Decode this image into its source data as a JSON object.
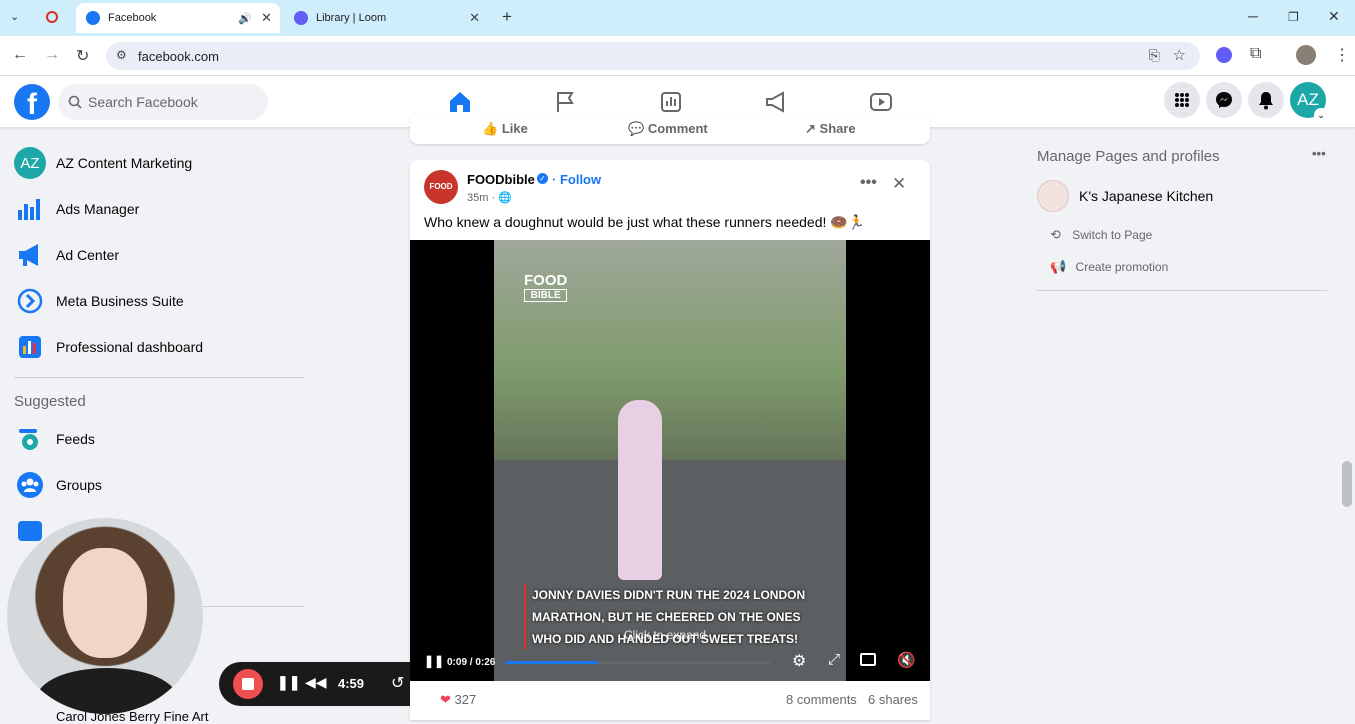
{
  "browser": {
    "tabs": [
      {
        "title": "Facebook",
        "active": true
      },
      {
        "title": "Library | Loom",
        "active": false
      }
    ],
    "url": "facebook.com"
  },
  "fb": {
    "search_placeholder": "Search Facebook",
    "avatar_initials": "AZ",
    "colors": {
      "brand": "#1877f2",
      "avatar": "#1ea7a7"
    }
  },
  "sidebar": {
    "items": [
      {
        "label": "AZ Content Marketing",
        "icon": "profile-avatar"
      },
      {
        "label": "Ads Manager",
        "icon": "bar-chart-icon"
      },
      {
        "label": "Ad Center",
        "icon": "megaphone-icon"
      },
      {
        "label": "Meta Business Suite",
        "icon": "business-suite-icon"
      },
      {
        "label": "Professional dashboard",
        "icon": "dashboard-icon"
      }
    ],
    "suggested_heading": "Suggested",
    "suggested": [
      {
        "label": "Feeds",
        "icon": "feeds-icon"
      },
      {
        "label": "Groups",
        "icon": "groups-icon"
      }
    ],
    "bottom_item": "Carol Jones Berry Fine Art"
  },
  "prev_post_actions": {
    "like": "Like",
    "comment": "Comment",
    "share": "Share"
  },
  "post": {
    "author": "FOODbible",
    "follow": "Follow",
    "time": "35m",
    "text": "Who knew a doughnut would be just what these runners needed! 🍩🏃",
    "video": {
      "caption_l1": "JONNY DAVIES DIDN'T RUN THE 2024 LONDON",
      "caption_l2": "MARATHON, BUT HE CHEERED ON THE ONES",
      "caption_l3": "WHO DID AND HANDED OUT SWEET TREATS!",
      "overlay": "Click to expand",
      "time": "0:09 / 0:26",
      "progress": 0.35,
      "watermark_l1": "FOOD",
      "watermark_l2": "BIBLE"
    },
    "reactions": "327",
    "comments": "8 comments",
    "shares": "6 shares"
  },
  "right": {
    "heading": "Manage Pages and profiles",
    "page_name": "K's Japanese Kitchen",
    "switch": "Switch to Page",
    "promo": "Create promotion"
  },
  "loom": {
    "timer": "4:59"
  }
}
